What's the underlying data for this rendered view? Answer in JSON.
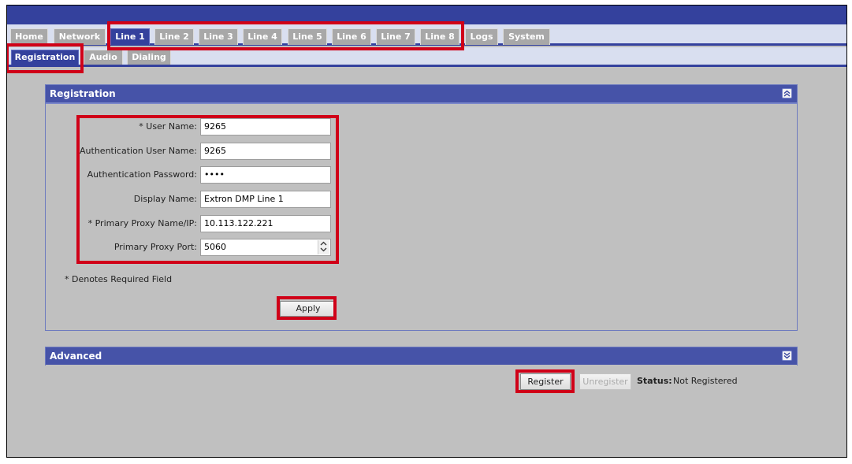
{
  "tabs": [
    {
      "label": "Home",
      "active": false
    },
    {
      "label": "Network",
      "active": false
    },
    {
      "label": "Line 1",
      "active": true
    },
    {
      "label": "Line 2",
      "active": false
    },
    {
      "label": "Line 3",
      "active": false
    },
    {
      "label": "Line 4",
      "active": false
    },
    {
      "label": "Line 5",
      "active": false
    },
    {
      "label": "Line 6",
      "active": false
    },
    {
      "label": "Line 7",
      "active": false
    },
    {
      "label": "Line 8",
      "active": false
    },
    {
      "label": "Logs",
      "active": false
    },
    {
      "label": "System",
      "active": false
    }
  ],
  "subtabs": [
    {
      "label": "Registration",
      "active": true
    },
    {
      "label": "Audio",
      "active": false
    },
    {
      "label": "Dialing",
      "active": false
    }
  ],
  "registration": {
    "title": "Registration",
    "fields": [
      {
        "label": "* User Name:",
        "value": "9265"
      },
      {
        "label": "Authentication User Name:",
        "value": "9265"
      },
      {
        "label": "Authentication Password:",
        "value": "••••"
      },
      {
        "label": "Display Name:",
        "value": "Extron DMP Line 1"
      },
      {
        "label": "* Primary Proxy Name/IP:",
        "value": "10.113.122.221"
      },
      {
        "label": "Primary Proxy Port:",
        "value": "5060"
      }
    ],
    "required_note": "* Denotes Required Field",
    "apply_label": "Apply"
  },
  "advanced": {
    "title": "Advanced",
    "register_label": "Register",
    "unregister_label": "Unregister",
    "status_label": "Status:",
    "status_value": "Not Registered"
  },
  "colors": {
    "accent": "#34419d",
    "highlight": "#d00018",
    "background": "#c0c0c0"
  }
}
